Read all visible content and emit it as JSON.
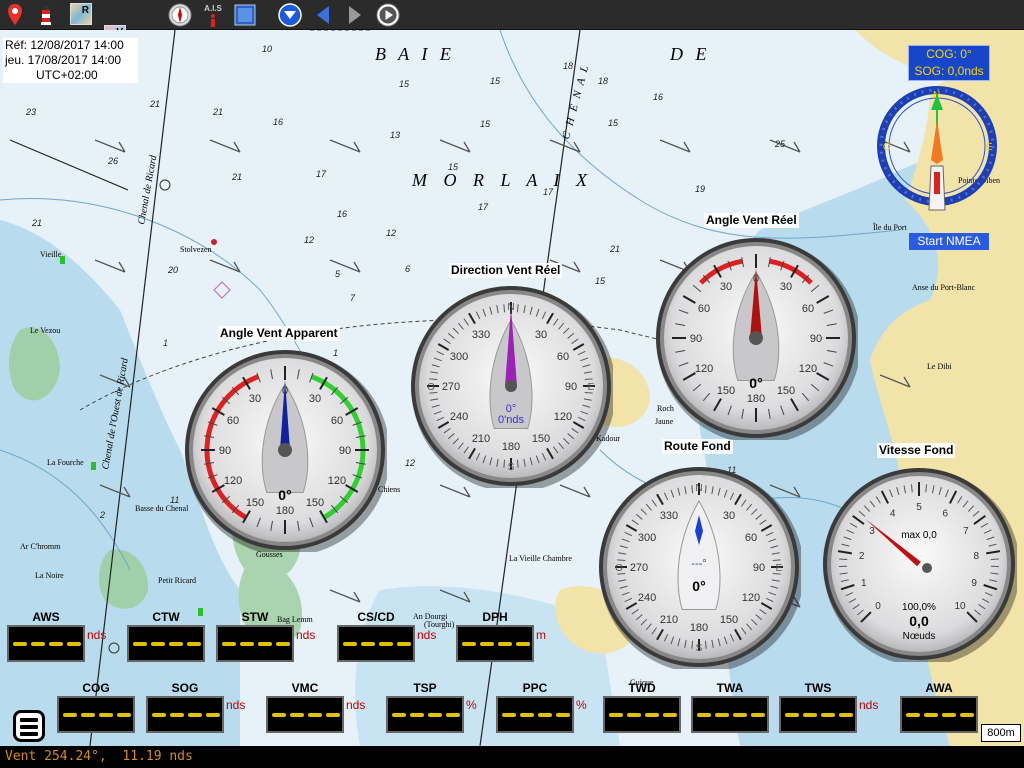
{
  "toolbar": {
    "tools": [
      {
        "name": "location-pin-icon"
      },
      {
        "name": "lighthouse-icon"
      },
      {
        "name": "raster-map-r",
        "label": "R"
      },
      {
        "name": "vector-map-v",
        "label": "V"
      },
      {
        "name": "map-m",
        "label": "M"
      },
      {
        "name": "compass-icon"
      },
      {
        "name": "ais-icon",
        "label": "A.I.S"
      },
      {
        "name": "blue-square-icon"
      },
      {
        "name": "down-arrow-circle-icon"
      },
      {
        "name": "back-arrow-icon"
      },
      {
        "name": "forward-arrow-icon"
      },
      {
        "name": "play-icon"
      }
    ]
  },
  "reference": {
    "ref_line": "Réf: 12/08/2017 14:00",
    "current_line": "jeu. 17/08/2017 14:00",
    "tz_line": "UTC+02:00"
  },
  "map_labels": {
    "baie": "B A I E",
    "de": "D E",
    "morlaix": "M O R L A I X",
    "chenal": "C H E N A L",
    "chenal_ricard": "Chenal de Ricard",
    "chenal_ouest": "Chenal de l'Ouest de Ricard",
    "stolvezen": "Stolvezen",
    "vieille": "Vieille",
    "vezou": "Le Vezou",
    "fourche": "La Fourche",
    "ile_du_port": "Île du Port",
    "anse": "Anse du Port-Blanc",
    "le_dibi": "Le Dibi",
    "pointe": "Pointe Diben",
    "la_noire": "La Noire",
    "gousses": "Gousses",
    "basse": "Basse du Chenal",
    "petit_ricard": "Petit Ricard",
    "la_vieille_chambre": "La Vieille Chambre",
    "an_dourgi": "An Dourgi",
    "dourgi_sub": "(Tourghi)",
    "bag_lemm": "Bag Lemm",
    "chiens": "Chiens",
    "kadour": "Kadour",
    "chrommm": "Ar C'hromm",
    "bag_ricard": "Bag Ricard",
    "guique": "Guique",
    "la_jaune": "Jaune",
    "roch": "Roch"
  },
  "nmea": {
    "cog_line": "COG: 0°",
    "sog_line": "SOG: 0,0nds",
    "start_label": "Start NMEA",
    "compass_letters": [
      "N",
      "E",
      "S",
      "O"
    ]
  },
  "gauges": {
    "apparent": {
      "title": "Angle Vent Apparent",
      "value": "0°",
      "scale": [
        "0",
        "30",
        "60",
        "90",
        "120",
        "150",
        "180",
        "150",
        "120",
        "90",
        "60",
        "30"
      ],
      "needle_deg": 0
    },
    "direction": {
      "title": "Direction Vent Réel",
      "value_deg": "0°",
      "value_speed": "0'nds",
      "scale": [
        "330",
        "30",
        "60",
        "90",
        "120",
        "150",
        "180",
        "210",
        "240",
        "270",
        "300"
      ],
      "cardinals": [
        "N",
        "E",
        "S",
        "O"
      ],
      "needle_deg": 0
    },
    "real": {
      "title": "Angle Vent Réel",
      "value": "0°",
      "scale": [
        "0",
        "30",
        "60",
        "90",
        "120",
        "150",
        "180",
        "150",
        "120",
        "90",
        "60",
        "30"
      ],
      "needle_deg": 0
    },
    "route": {
      "title": "Route Fond",
      "value_speed": "---°",
      "value": "0°",
      "scale": [
        "330",
        "30",
        "60",
        "90",
        "120",
        "150",
        "180",
        "210",
        "240",
        "270",
        "300"
      ],
      "cardinals": [
        "N",
        "E",
        "S",
        "O"
      ],
      "needle_deg": 0
    },
    "speed": {
      "title": "Vitesse Fond",
      "max_label": "max 0,0",
      "percent": "100,0%",
      "value": "0,0",
      "unit": "Nœuds",
      "scale": [
        "0",
        "1",
        "2",
        "3",
        "4",
        "5",
        "6",
        "7",
        "8",
        "9",
        "10"
      ],
      "value_knots": 0
    }
  },
  "instruments_row1": [
    {
      "label": "AWS",
      "unit": "nds"
    },
    {
      "label": "CTW",
      "unit": ""
    },
    {
      "label": "STW",
      "unit": "nds"
    },
    {
      "label": "CS/CD",
      "unit": "nds"
    },
    {
      "label": "DPH",
      "unit": "m"
    }
  ],
  "instruments_row2": [
    {
      "label": "COG",
      "unit": ""
    },
    {
      "label": "SOG",
      "unit": "nds"
    },
    {
      "label": "VMC",
      "unit": "nds"
    },
    {
      "label": "TSP",
      "unit": "%"
    },
    {
      "label": "PPC",
      "unit": "%"
    },
    {
      "label": "TWD",
      "unit": ""
    },
    {
      "label": "TWA",
      "unit": ""
    },
    {
      "label": "TWS",
      "unit": "nds"
    },
    {
      "label": "AWA",
      "unit": ""
    }
  ],
  "scale_bar": "800m",
  "status_line": "Vent 254.24°,  11.19 nds",
  "colors": {
    "sea_deep": "#e6f1f8",
    "sea_shallow": "#b8dcee",
    "land": "#f2e3a8",
    "rock": "#7cc1de",
    "gauge_red": "#e02020",
    "gauge_green": "#30d030",
    "needle_blue": "#1020a0",
    "needle_purple": "#9b22b6",
    "needle_red": "#b01010",
    "status": "#d48c1a"
  }
}
